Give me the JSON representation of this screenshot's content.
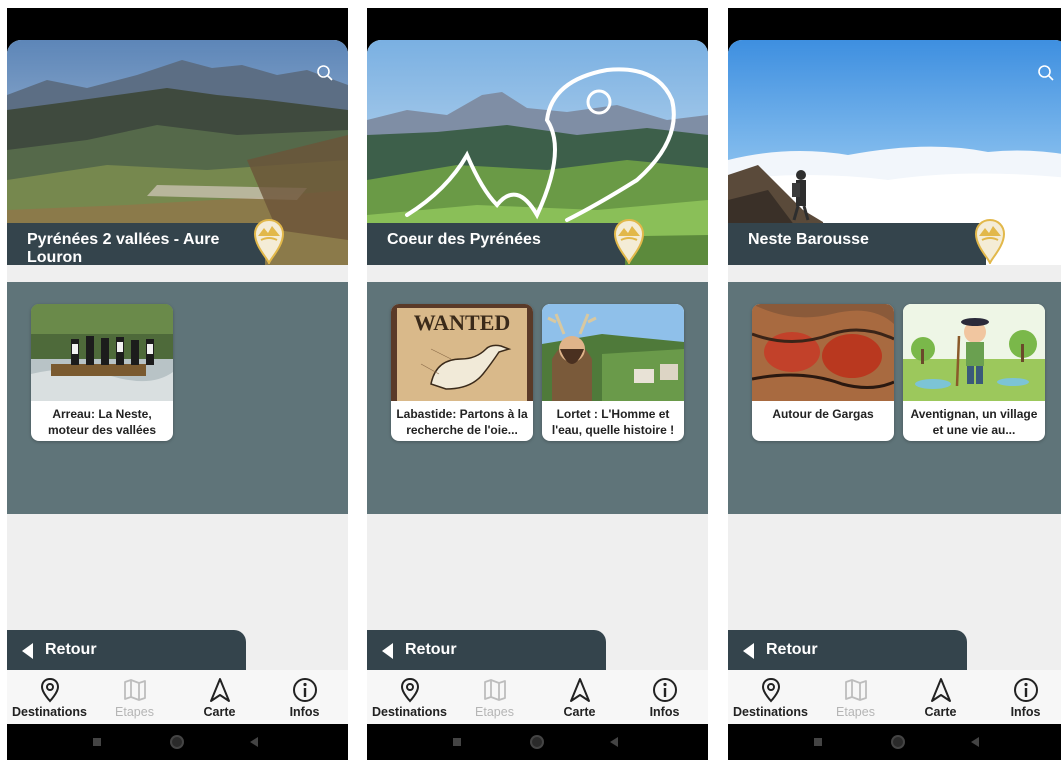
{
  "screens": [
    {
      "title": "Pyrénées 2 vallées - Aure Louron",
      "hero_scene": "mountain-valley-village",
      "cards": [
        {
          "caption": "Arreau: La Neste, moteur des vallées",
          "image": "rafting-river"
        }
      ],
      "show_search": true,
      "logo": false
    },
    {
      "title": "Coeur des Pyrénées",
      "hero_scene": "green-hills-with-heart-logo",
      "cards": [
        {
          "caption": "Labastide: Partons à la recherche de l'oie...",
          "image": "wanted-goose-poster"
        },
        {
          "caption": "Lortet : L'Homme et l'eau, quelle histoire !",
          "image": "antlered-man-village"
        }
      ],
      "show_search": false,
      "logo": true
    },
    {
      "title": "Neste Barousse",
      "hero_scene": "hiker-above-clouds",
      "cards": [
        {
          "caption": "Autour de Gargas",
          "image": "cave-hand-paintings"
        },
        {
          "caption": "Aventignan, un village et une vie au...",
          "image": "cartoon-farmer"
        }
      ],
      "show_search": true,
      "logo": false
    }
  ],
  "back_label": "Retour",
  "nav": [
    {
      "label": "Destinations",
      "icon": "map-pin-icon",
      "enabled": true
    },
    {
      "label": "Etapes",
      "icon": "map-icon",
      "enabled": false
    },
    {
      "label": "Carte",
      "icon": "navigation-arrow-icon",
      "enabled": true
    },
    {
      "label": "Infos",
      "icon": "info-icon",
      "enabled": true
    }
  ],
  "colors": {
    "title_bar": "#34444c",
    "band": "#5f7479",
    "background": "#efefef",
    "badge": "#e2b84a"
  }
}
